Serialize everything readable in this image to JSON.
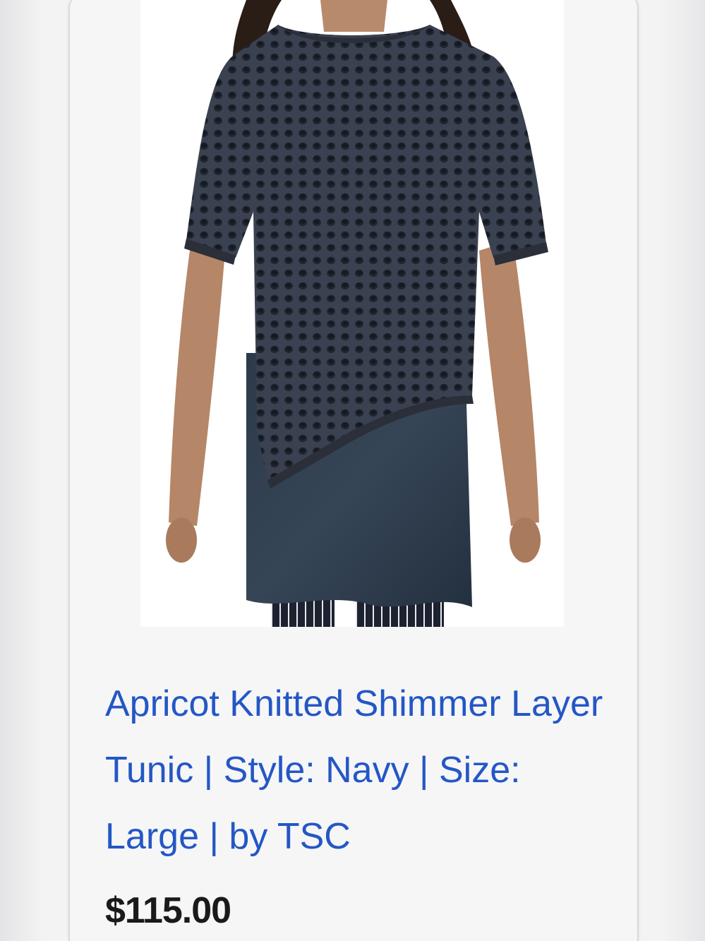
{
  "product": {
    "title": "Apricot Knitted Shimmer Layer Tunic | Style: Navy | Size: Large | by TSC",
    "price": "$115.00",
    "image_alt": "Model wearing navy open-knit layered tunic with striped trousers"
  },
  "colors": {
    "link": "#2457c5",
    "price": "#1a1a1a",
    "garment": "#2c3340"
  }
}
